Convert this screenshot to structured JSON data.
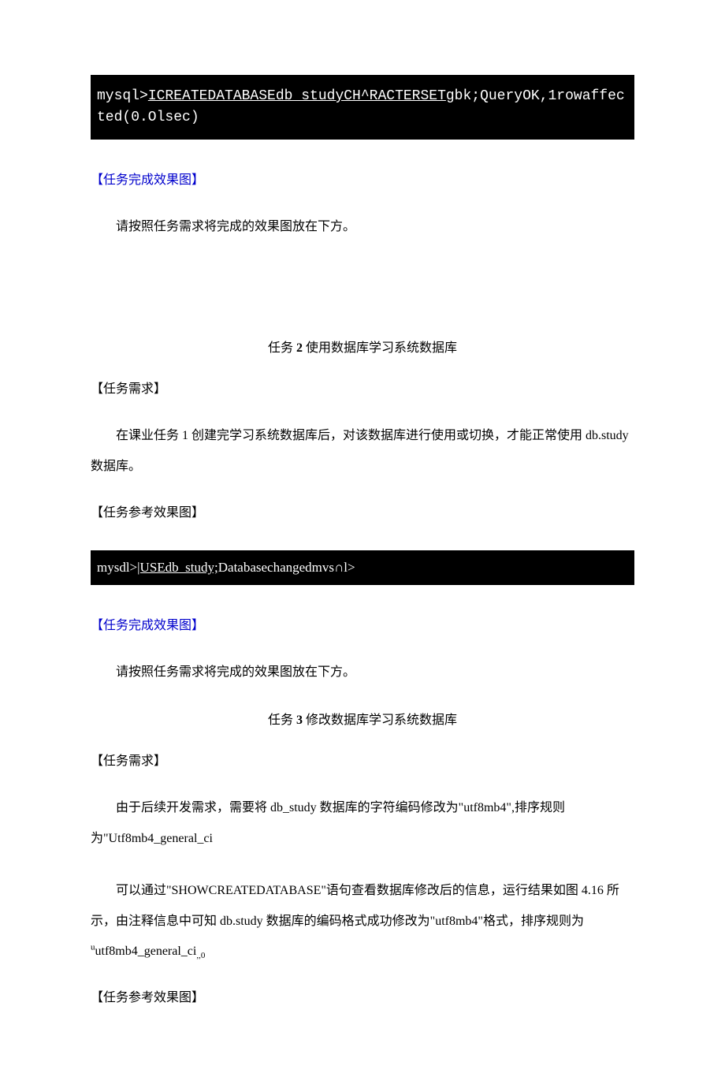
{
  "codeblock1": {
    "part1": "mysql>",
    "underlined": "ICREATEDATABASEdb studyCH^RACTERSET",
    "part2": "gbk;QueryOK,1rowaffected(0.Olsec)"
  },
  "section1": {
    "heading": "【任务完成效果图】",
    "para": "请按照任务需求将完成的效果图放在下方。"
  },
  "task2": {
    "title_prefix": "任务 ",
    "title_num": "2",
    "title_rest": " 使用数据库学习系统数据库",
    "req_heading": "【任务需求】",
    "req_para_a": "在课业任务 1 创建完学习系统数据库后，对该数据库进行使用或切换，才能正常使用 db.study数据库。",
    "ref_heading": "【任务参考效果图】"
  },
  "codeblock2": {
    "part1": "mysdl>",
    "underlined": "|USEdb_study;",
    "part2": "Databasechangedmvs∩l>"
  },
  "section2": {
    "heading": "【任务完成效果图】",
    "para": "请按照任务需求将完成的效果图放在下方。"
  },
  "task3": {
    "title_prefix": "任务 ",
    "title_num": "3",
    "title_rest": " 修改数据库学习系统数据库",
    "req_heading": "【任务需求】",
    "req_para1": "由于后续开发需求，需要将 db_study 数据库的字符编码修改为\"utf8mb4\",排序规则为\"Utf8mb4_general_ci",
    "req_para2_a": "可以通过\"SHOWCREATEDATABASE\"语句查看数据库修改后的信息，运行结果如图 4.16 所示，由注释信息中可知 db.study 数据库的编码格式成功修改为\"utf8mb4\"格式，排序规则为",
    "req_para2_sup": "u",
    "req_para2_mid": "utf8mb4_general_ci",
    "req_para2_sub": ",,0",
    "ref_heading": "【任务参考效果图】"
  }
}
